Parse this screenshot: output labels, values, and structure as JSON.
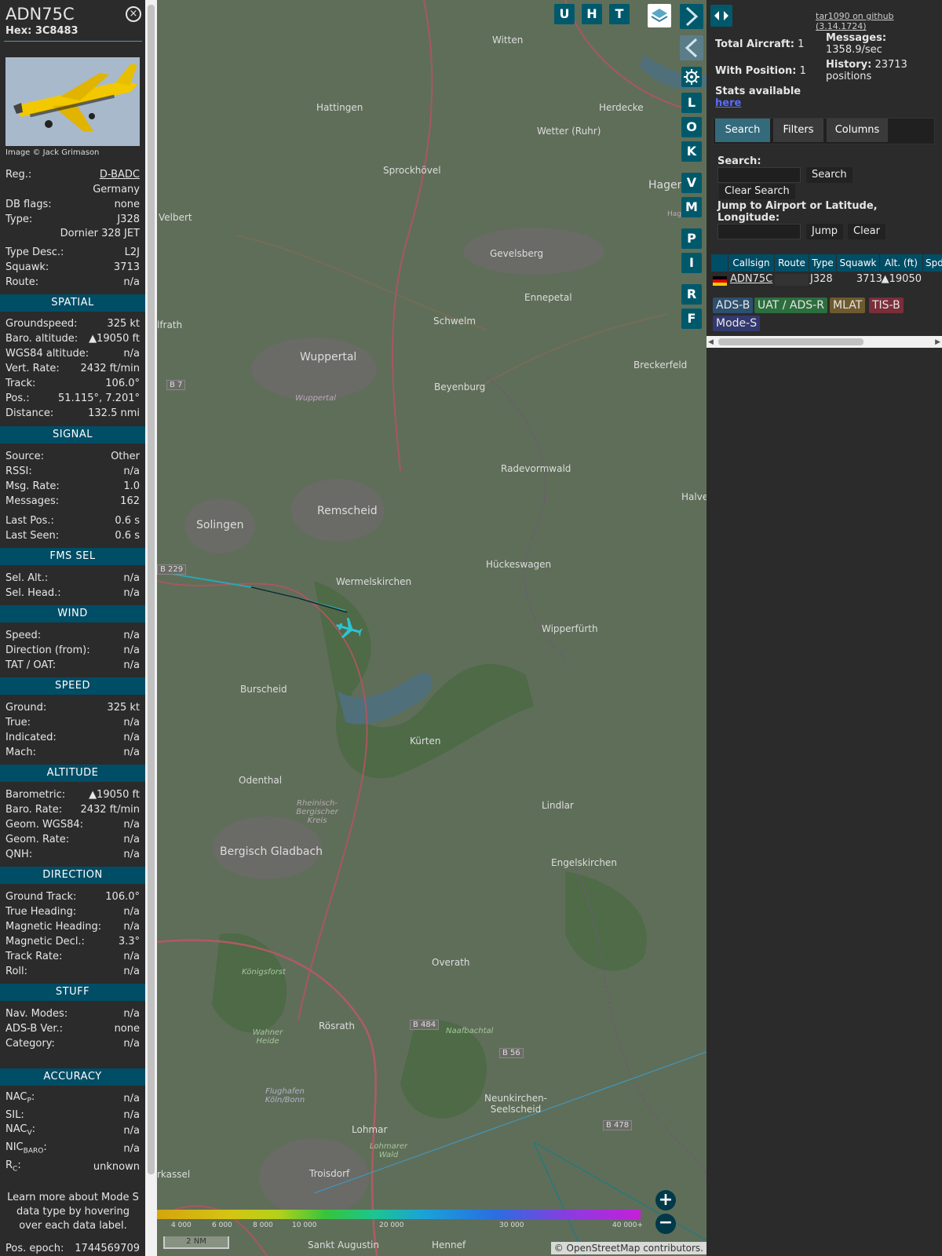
{
  "aircraft": {
    "callsign": "ADN75C",
    "hex_label": "Hex:",
    "hex": "3C8483",
    "close_glyph": "×",
    "image_credit": "Image © Jack Grimason"
  },
  "info_rows": [
    {
      "label": "Reg.:",
      "value": "D-BADC"
    },
    {
      "label": "DB flags:",
      "value": "none"
    },
    {
      "label": "Type:",
      "value": "J328"
    },
    {
      "label": "Type Desc.:",
      "value": "L2J"
    },
    {
      "label": "Squawk:",
      "value": "3713"
    },
    {
      "label": "Route:",
      "value": "n/a"
    }
  ],
  "reg_country": "Germany",
  "type_name": "Dornier 328 JET",
  "sections": {
    "spatial": {
      "title": "SPATIAL",
      "rows": [
        {
          "label": "Groundspeed:",
          "value": "325 kt"
        },
        {
          "label": "Baro. altitude:",
          "value": "▲19050 ft"
        },
        {
          "label": "WGS84 altitude:",
          "value": "n/a"
        },
        {
          "label": "Vert. Rate:",
          "value": "2432 ft/min"
        },
        {
          "label": "Track:",
          "value": "106.0°"
        },
        {
          "label": "Pos.:",
          "value": "51.115°, 7.201°"
        },
        {
          "label": "Distance:",
          "value": "132.5 nmi"
        }
      ]
    },
    "signal": {
      "title": "SIGNAL",
      "rows": [
        {
          "label": "Source:",
          "value": "Other"
        },
        {
          "label": "RSSI:",
          "value": "n/a"
        },
        {
          "label": "Msg. Rate:",
          "value": "1.0"
        },
        {
          "label": "Messages:",
          "value": "162"
        },
        {
          "label": "Last Pos.:",
          "value": "0.6 s"
        },
        {
          "label": "Last Seen:",
          "value": "0.6 s"
        }
      ]
    },
    "fms": {
      "title": "FMS SEL",
      "rows": [
        {
          "label": "Sel. Alt.:",
          "value": "n/a"
        },
        {
          "label": "Sel. Head.:",
          "value": "n/a"
        }
      ]
    },
    "wind": {
      "title": "WIND",
      "rows": [
        {
          "label": "Speed:",
          "value": "n/a"
        },
        {
          "label": "Direction (from):",
          "value": "n/a"
        },
        {
          "label": "TAT / OAT:",
          "value": "n/a"
        }
      ]
    },
    "speed": {
      "title": "SPEED",
      "rows": [
        {
          "label": "Ground:",
          "value": "325 kt"
        },
        {
          "label": "True:",
          "value": "n/a"
        },
        {
          "label": "Indicated:",
          "value": "n/a"
        },
        {
          "label": "Mach:",
          "value": "n/a"
        }
      ]
    },
    "altitude": {
      "title": "ALTITUDE",
      "rows": [
        {
          "label": "Barometric:",
          "value": "▲19050 ft"
        },
        {
          "label": "Baro. Rate:",
          "value": "2432 ft/min"
        },
        {
          "label": "Geom. WGS84:",
          "value": "n/a"
        },
        {
          "label": "Geom. Rate:",
          "value": "n/a"
        },
        {
          "label": "QNH:",
          "value": "n/a"
        }
      ]
    },
    "direction": {
      "title": "DIRECTION",
      "rows": [
        {
          "label": "Ground Track:",
          "value": "106.0°"
        },
        {
          "label": "True Heading:",
          "value": "n/a"
        },
        {
          "label": "Magnetic Heading:",
          "value": "n/a"
        },
        {
          "label": "Magnetic Decl.:",
          "value": "3.3°"
        },
        {
          "label": "Track Rate:",
          "value": "n/a"
        },
        {
          "label": "Roll:",
          "value": "n/a"
        }
      ]
    },
    "stuff": {
      "title": "STUFF",
      "rows": [
        {
          "label": "Nav. Modes:",
          "value": "n/a"
        },
        {
          "label": "ADS-B Ver.:",
          "value": "none"
        },
        {
          "label": "Category:",
          "value": "n/a"
        }
      ]
    },
    "accuracy": {
      "title": "ACCURACY",
      "rows": [
        {
          "label": "NAC",
          "sub": "P",
          "value": "n/a"
        },
        {
          "label": "SIL:",
          "sub": "",
          "value": "n/a"
        },
        {
          "label": "NAC",
          "sub": "V",
          "value": "n/a"
        },
        {
          "label": "NIC",
          "sub": "BARO",
          "value": "n/a"
        },
        {
          "label": "R",
          "sub": "C",
          "value": "unknown"
        }
      ]
    }
  },
  "footer_note": "Learn more about Mode S data type by hovering over each data label.",
  "pos_epoch": {
    "label": "Pos. epoch:",
    "value": "1744569709"
  },
  "map": {
    "top_buttons": [
      "U",
      "H",
      "T"
    ],
    "side_buttons": [
      "L",
      "O",
      "K",
      "V",
      "M",
      "P",
      "I",
      "R",
      "F"
    ],
    "places": [
      {
        "name": "Witten"
      },
      {
        "name": "Hattingen"
      },
      {
        "name": "Herdecke"
      },
      {
        "name": "Wetter (Ruhr)"
      },
      {
        "name": "Sprockhövel"
      },
      {
        "name": "Hagen"
      },
      {
        "name": "Velbert"
      },
      {
        "name": "Gevelsberg"
      },
      {
        "name": "Ennepetal"
      },
      {
        "name": "Schwelm"
      },
      {
        "name": "Wuppertal"
      },
      {
        "name": "Beyenburg"
      },
      {
        "name": "Breckerfeld"
      },
      {
        "name": "Radevormwald"
      },
      {
        "name": "Remscheid"
      },
      {
        "name": "Solingen"
      },
      {
        "name": "Halver"
      },
      {
        "name": "Hückeswagen"
      },
      {
        "name": "Wermelskirchen"
      },
      {
        "name": "Wipperfürth"
      },
      {
        "name": "Burscheid"
      },
      {
        "name": "Kürten"
      },
      {
        "name": "Odenthal"
      },
      {
        "name": "Lindlar"
      },
      {
        "name": "Bergisch Gladbach"
      },
      {
        "name": "Engelskirchen"
      },
      {
        "name": "Overath"
      },
      {
        "name": "Rösrath"
      },
      {
        "name": "Neunkirchen-Seelscheid"
      },
      {
        "name": "Lohmar"
      },
      {
        "name": "Troisdorf"
      },
      {
        "name": "Sankt Augustin"
      },
      {
        "name": "Hennef"
      },
      {
        "name": "Königsforst"
      },
      {
        "name": "Naafbachtal"
      },
      {
        "name": "Wahner Heide"
      },
      {
        "name": "Flughafen Köln/Bonn"
      },
      {
        "name": "Rheinisch-Bergischer Kreis"
      },
      {
        "name": "Lohmarer Wald"
      },
      {
        "name": "Wuppertal"
      },
      {
        "name": "B 7"
      },
      {
        "name": "B 229"
      },
      {
        "name": "B 484"
      },
      {
        "name": "B 56"
      },
      {
        "name": "B 478"
      },
      {
        "name": "lfrath"
      },
      {
        "name": "rkassel"
      },
      {
        "name": "Hag"
      }
    ],
    "altitude_scale": [
      "4 000",
      "6 000",
      "8 000",
      "10 000",
      "20 000",
      "30 000",
      "40 000+"
    ],
    "scale_bar": "2 NM",
    "attribution": "© OpenStreetMap contributors.",
    "zoom_in": "+",
    "zoom_out": "−"
  },
  "panel": {
    "github_link": "tar1090 on github (3.14.1724)",
    "total_aircraft_label": "Total Aircraft:",
    "total_aircraft": "1",
    "messages_label": "Messages:",
    "messages_rate": "1358.9/sec",
    "with_position_label": "With Position:",
    "with_position": "1",
    "history_label": "History:",
    "history": "23713 positions",
    "stats_label": "Stats available",
    "stats_link": "here",
    "tabs": [
      "Search",
      "Filters",
      "Columns"
    ],
    "search_label": "Search:",
    "search_button": "Search",
    "clear_search_button": "Clear Search",
    "jump_label": "Jump to Airport or Latitude, Longitude:",
    "jump_button": "Jump",
    "clear_button": "Clear",
    "columns": [
      "Callsign",
      "Route",
      "Type",
      "Squawk",
      "Alt. (ft)",
      "Spd"
    ],
    "rows": [
      {
        "callsign": "ADN75C",
        "route": "",
        "type": "J328",
        "squawk": "3713",
        "alt": "▲19050"
      }
    ],
    "sources": [
      "ADS-B",
      "UAT / ADS-R",
      "MLAT",
      "TIS-B",
      "Mode-S"
    ]
  }
}
